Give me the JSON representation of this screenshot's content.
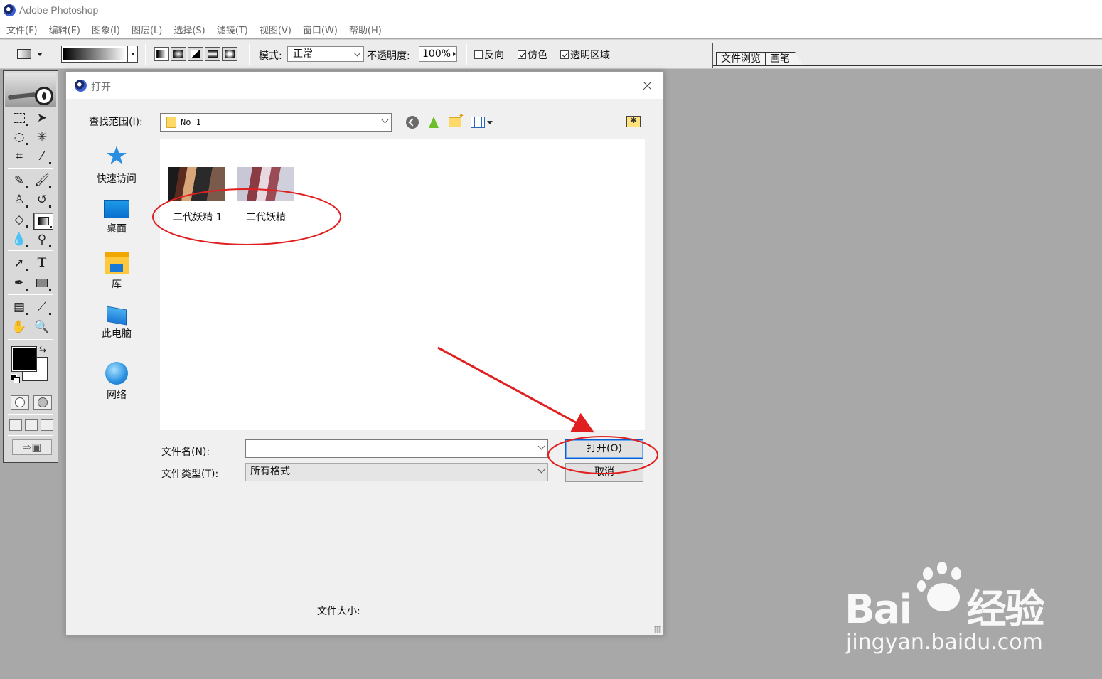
{
  "app": {
    "title": "Adobe Photoshop"
  },
  "menu": [
    "文件(F)",
    "编辑(E)",
    "图象(I)",
    "图层(L)",
    "选择(S)",
    "滤镜(T)",
    "视图(V)",
    "窗口(W)",
    "帮助(H)"
  ],
  "options": {
    "mode_label": "模式:",
    "mode_value": "正常",
    "opacity_label": "不透明度:",
    "opacity_value": "100%",
    "reverse_label": "反向",
    "reverse_checked": false,
    "dither_label": "仿色",
    "dither_checked": true,
    "transparency_label": "透明区域",
    "transparency_checked": true
  },
  "palette_well": {
    "tabs": [
      "文件浏览",
      "画笔"
    ]
  },
  "dialog": {
    "title": "打开",
    "look_in_label": "查找范围(I):",
    "look_in_value": "No 1",
    "places": [
      "快速访问",
      "桌面",
      "库",
      "此电脑",
      "网络"
    ],
    "files": [
      "二代妖精 1",
      "二代妖精"
    ],
    "filename_label": "文件名(N):",
    "filename_value": "",
    "filetype_label": "文件类型(T):",
    "filetype_value": "所有格式",
    "open_button": "打开(O)",
    "cancel_button": "取消",
    "filesize_label": "文件大小:"
  },
  "annotation": {
    "color": "#e02020"
  },
  "watermark": {
    "logo_left": "Bai",
    "logo_right": "经验",
    "url": "jingyan.baidu.com"
  }
}
